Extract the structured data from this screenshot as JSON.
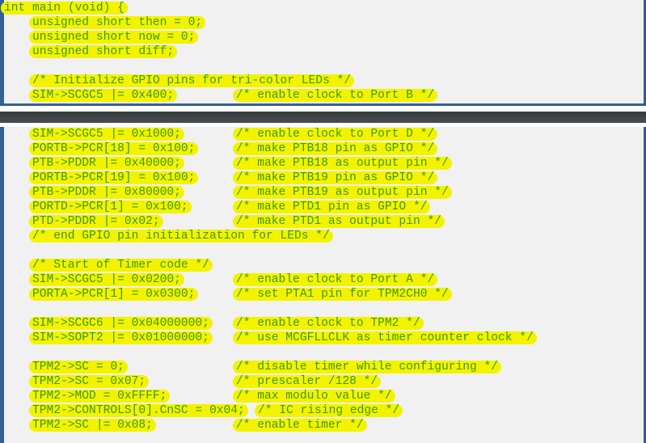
{
  "theme": {
    "highlight_color": "#f3f300",
    "code_color": "#3f9a0a",
    "panel_border_color": "#336095",
    "panel_background": "#f1f1f1"
  },
  "top_snippet": {
    "lines": [
      {
        "code": "int main (void) {",
        "comment": ""
      },
      {
        "code": "unsigned short then = 0;",
        "comment": ""
      },
      {
        "code": "unsigned short now = 0;",
        "comment": ""
      },
      {
        "code": "unsigned short diff;",
        "comment": ""
      },
      {
        "code": "/* Initialize GPIO pins for tri-color LEDs */",
        "comment": ""
      },
      {
        "code": "SIM->SCGC5 |= 0x400;",
        "comment": "/* enable clock to Port B */"
      }
    ]
  },
  "bottom_snippet": {
    "gpio_block": [
      {
        "code": "SIM->SCGC5 |= 0x1000;",
        "comment": "/* enable clock to Port D */"
      },
      {
        "code": "PORTB->PCR[18] = 0x100;",
        "comment": "/* make PTB18 pin as GPIO */"
      },
      {
        "code": "PTB->PDDR |= 0x40000;",
        "comment": "/* make PTB18 as output pin */"
      },
      {
        "code": "PORTB->PCR[19] = 0x100;",
        "comment": "/* make PTB19 pin as GPIO */"
      },
      {
        "code": "PTB->PDDR |= 0x80000;",
        "comment": "/* make PTB19 as output pin */"
      },
      {
        "code": "PORTD->PCR[1] = 0x100;",
        "comment": "/* make PTD1 pin as GPIO */"
      },
      {
        "code": "PTD->PDDR |= 0x02;",
        "comment": "/* make PTD1 as output pin */"
      },
      {
        "code": "/* end GPIO pin initialization for LEDs */",
        "comment": ""
      }
    ],
    "timer_start_block": [
      {
        "code": "/* Start of Timer code */",
        "comment": ""
      },
      {
        "code": "SIM->SCGC5 |= 0x0200;",
        "comment": "/* enable clock to Port A */"
      },
      {
        "code": "PORTA->PCR[1] = 0x0300;",
        "comment": "/* set PTA1 pin for TPM2CH0 */"
      }
    ],
    "clock_block": [
      {
        "code": "SIM->SCGC6 |= 0x04000000;",
        "comment": "/* enable clock to TPM2 */"
      },
      {
        "code": "SIM->SOPT2 |= 0x01000000;",
        "comment": "/* use MCGFLLCLK as timer counter clock */"
      }
    ],
    "tpm_block": [
      {
        "code": "TPM2->SC = 0;",
        "comment": "/* disable timer while configuring */"
      },
      {
        "code": "TPM2->SC = 0x07;",
        "comment": "/* prescaler /128 */"
      },
      {
        "code": "TPM2->MOD = 0xFFFF;",
        "comment": "/* max modulo value */"
      },
      {
        "code": "TPM2->CONTROLS[0].CnSC = 0x04;",
        "comment": "/* IC rising edge */"
      },
      {
        "code": "TPM2->SC |= 0x08;",
        "comment": "/* enable timer */"
      }
    ]
  }
}
